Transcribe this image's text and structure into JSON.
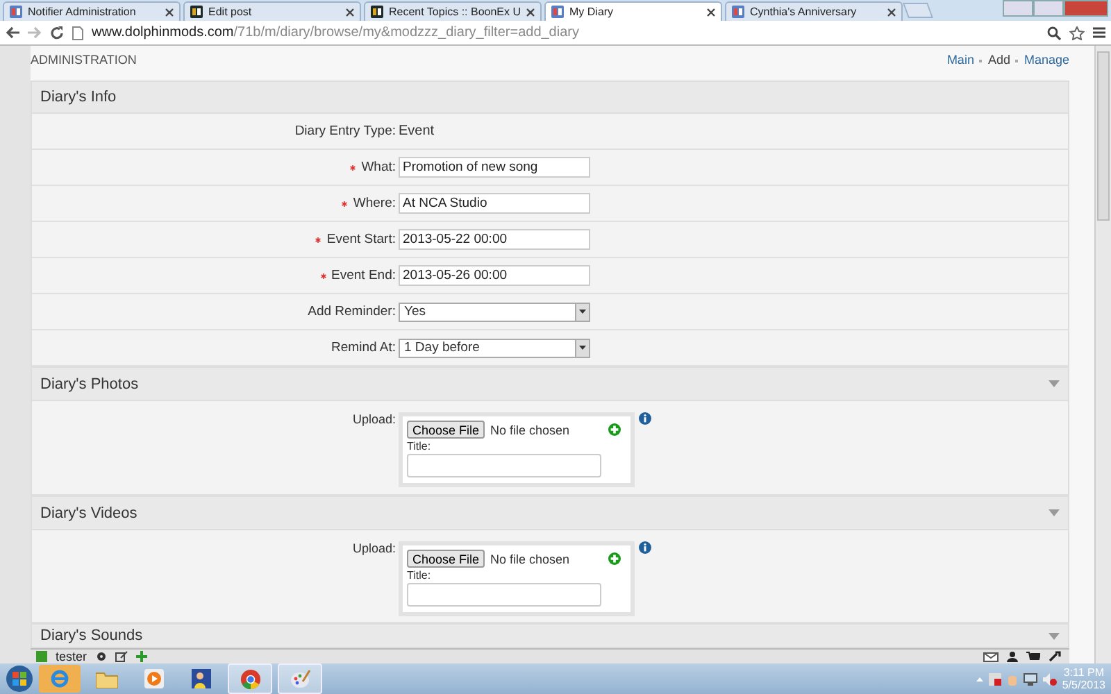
{
  "browser": {
    "tabs": [
      {
        "title": "Notifier Administration",
        "selected": false
      },
      {
        "title": "Edit post",
        "selected": false
      },
      {
        "title": "Recent Topics :: BoonEx U",
        "selected": false
      },
      {
        "title": "My Diary",
        "selected": true
      },
      {
        "title": "Cynthia's Anniversary",
        "selected": false
      }
    ],
    "url_host": "www.dolphinmods.com",
    "url_path": "/71b/m/diary/browse/my&modzzz_diary_filter=add_diary"
  },
  "page": {
    "heading": "ADMINISTRATION",
    "nav": [
      "Main",
      "Add",
      "Manage"
    ]
  },
  "sections": [
    {
      "title": "Diary's Info",
      "kind": "fields",
      "fields": [
        {
          "kind": "static",
          "label": "Diary Entry Type:",
          "value": "Event",
          "required": false
        },
        {
          "kind": "text",
          "label": "What:",
          "value": "Promotion of new song",
          "required": true
        },
        {
          "kind": "text",
          "label": "Where:",
          "value": "At NCA Studio",
          "required": true
        },
        {
          "kind": "text",
          "label": "Event Start:",
          "value": "2013-05-22 00:00",
          "required": true
        },
        {
          "kind": "text",
          "label": "Event End:",
          "value": "2013-05-26 00:00",
          "required": true
        },
        {
          "kind": "select",
          "label": "Add Reminder:",
          "value": "Yes",
          "required": false
        },
        {
          "kind": "select",
          "label": "Remind At:",
          "value": "1 Day before",
          "required": false
        }
      ]
    },
    {
      "title": "Diary's Photos",
      "kind": "upload",
      "upload": {
        "label": "Upload:",
        "button": "Choose File",
        "status": "No file chosen",
        "title_label": "Title:"
      }
    },
    {
      "title": "Diary's Videos",
      "kind": "upload",
      "upload": {
        "label": "Upload:",
        "button": "Choose File",
        "status": "No file chosen",
        "title_label": "Title:"
      }
    },
    {
      "title": "Diary's Sounds",
      "kind": "header"
    }
  ],
  "bottom_bar": {
    "user": "tester"
  },
  "taskbar": {
    "time": "3:11 PM",
    "date": "5/5/2013"
  }
}
